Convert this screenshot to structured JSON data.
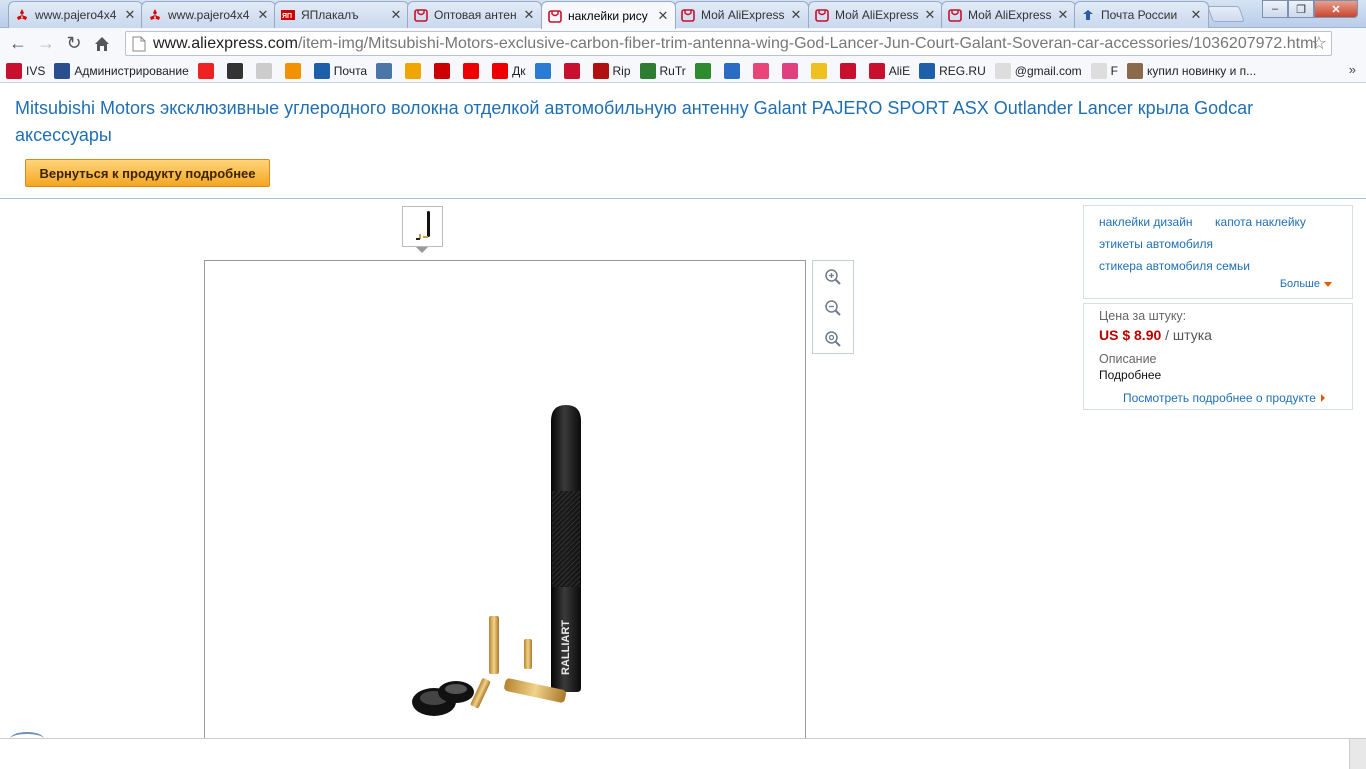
{
  "browser": {
    "tabs": [
      {
        "title": "www.pajero4x4",
        "icon": "mitsubishi-icon"
      },
      {
        "title": "www.pajero4x4",
        "icon": "mitsubishi-icon"
      },
      {
        "title": "ЯПлакалъ",
        "icon": "yaplakal-icon"
      },
      {
        "title": "Оптовая антен",
        "icon": "aliexpress-icon"
      },
      {
        "title": "наклейки рису",
        "icon": "aliexpress-icon",
        "active": true
      },
      {
        "title": "Мой AliExpress",
        "icon": "aliexpress-icon"
      },
      {
        "title": "Мой AliExpress",
        "icon": "aliexpress-icon"
      },
      {
        "title": "Мой AliExpress",
        "icon": "aliexpress-icon"
      },
      {
        "title": "Почта России",
        "icon": "russian-post-icon"
      }
    ],
    "url_host": "www.aliexpress.com",
    "url_path": "/item-img/Mitsubishi-Motors-exclusive-carbon-fiber-trim-antenna-wing-God-Lancer-Jun-Court-Galant-Soveran-car-accessories/1036207972.html",
    "bookmarks": [
      {
        "label": "IVS",
        "color": "#c8102e"
      },
      {
        "label": "Администрирование",
        "color": "#2a4f8f"
      },
      {
        "label": "",
        "color": "#e22"
      },
      {
        "label": "",
        "color": "#333"
      },
      {
        "label": "",
        "color": "#ccc"
      },
      {
        "label": "",
        "color": "#f39200"
      },
      {
        "label": "Почта",
        "color": "#1d5fa8"
      },
      {
        "label": "",
        "color": "#4a76a8"
      },
      {
        "label": "",
        "color": "#f0a500"
      },
      {
        "label": "",
        "color": "#c00"
      },
      {
        "label": "",
        "color": "#e00"
      },
      {
        "label": "Дк",
        "color": "#e00"
      },
      {
        "label": "",
        "color": "#2a7bd4"
      },
      {
        "label": "",
        "color": "#c8102e"
      },
      {
        "label": "Rip",
        "color": "#b01010"
      },
      {
        "label": "RuTr",
        "color": "#2f7d32"
      },
      {
        "label": "",
        "color": "#2e8b2e"
      },
      {
        "label": "",
        "color": "#2a6cc4"
      },
      {
        "label": "",
        "color": "#e8457a"
      },
      {
        "label": "",
        "color": "#e04080"
      },
      {
        "label": "",
        "color": "#f0c020"
      },
      {
        "label": "",
        "color": "#c8102e"
      },
      {
        "label": "AliE",
        "color": "#c8102e"
      },
      {
        "label": "REG.RU",
        "color": "#1d5fa8"
      },
      {
        "label": "@gmail.com",
        "color": "#ddd"
      },
      {
        "label": "F",
        "color": "#ddd"
      },
      {
        "label": "купил новинку и п...",
        "color": "#8a6a4a"
      }
    ],
    "bookmarks_more": "»"
  },
  "page": {
    "title": "Mitsubishi Motors эксклюзивные углеродного волокна отделкой автомобильную антенну Galant PAJERO SPORT ASX Outlander Lancer крыла Godcar аксессуары",
    "back_button": "Вернуться к продукту подробнее",
    "tags": [
      "наклейки дизайн",
      "капота наклейку",
      "этикеты автомобиля",
      "стикера автомобиля семьи"
    ],
    "more": "Больше",
    "price_label": "Цена за штуку:",
    "price_amount": "US $ 8.90",
    "price_unit": "/ штука",
    "desc_label": "Описание",
    "desc_value": "Подробнее",
    "details_link": "Посмотреть подробнее о продукте",
    "antenna_brand": "RALLIART",
    "accent_color": "#1f6fb5",
    "price_color": "#bb0000",
    "button_color": "#f5a623"
  }
}
